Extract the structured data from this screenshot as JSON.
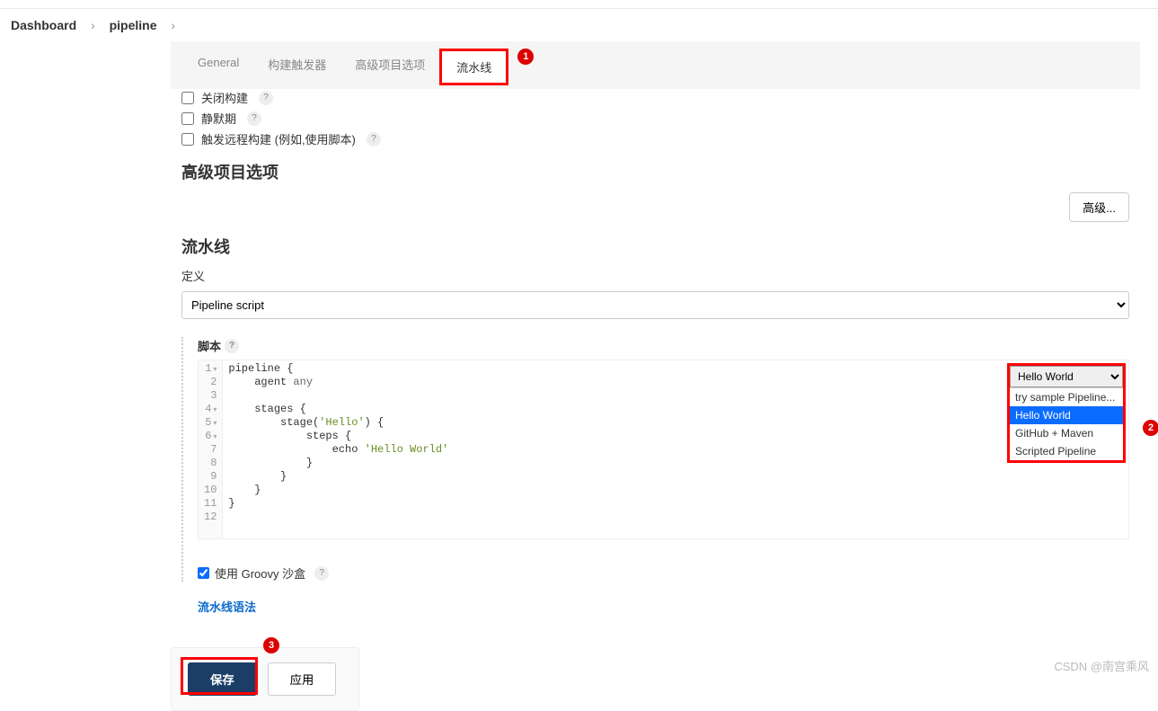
{
  "breadcrumb": {
    "dashboard": "Dashboard",
    "pipeline": "pipeline"
  },
  "tabs": {
    "general": "General",
    "triggers": "构建触发器",
    "advanced": "高级项目选项",
    "pipeline": "流水线"
  },
  "annotations": {
    "a1": "1",
    "a2": "2",
    "a3": "3"
  },
  "checks": {
    "disable_build": "关闭构建",
    "quiet_period": "静默期",
    "remote_trigger": "触发远程构建 (例如,使用脚本)"
  },
  "sections": {
    "advanced_title": "高级项目选项",
    "advanced_btn": "高级...",
    "pipeline_title": "流水线",
    "definition_label": "定义",
    "definition_value": "Pipeline script",
    "script_label": "脚本",
    "groovy_sandbox": "使用 Groovy 沙盒",
    "syntax_link": "流水线语法"
  },
  "sample": {
    "selected": "Hello World",
    "options": [
      "try sample Pipeline...",
      "Hello World",
      "GitHub + Maven",
      "Scripted Pipeline"
    ]
  },
  "code": {
    "lines": [
      "pipeline {",
      "    agent any",
      "",
      "    stages {",
      "        stage('Hello') {",
      "            steps {",
      "                echo 'Hello World'",
      "            }",
      "        }",
      "    }",
      "}",
      ""
    ]
  },
  "buttons": {
    "save": "保存",
    "apply": "应用"
  },
  "watermark": "CSDN @南宫乘风"
}
